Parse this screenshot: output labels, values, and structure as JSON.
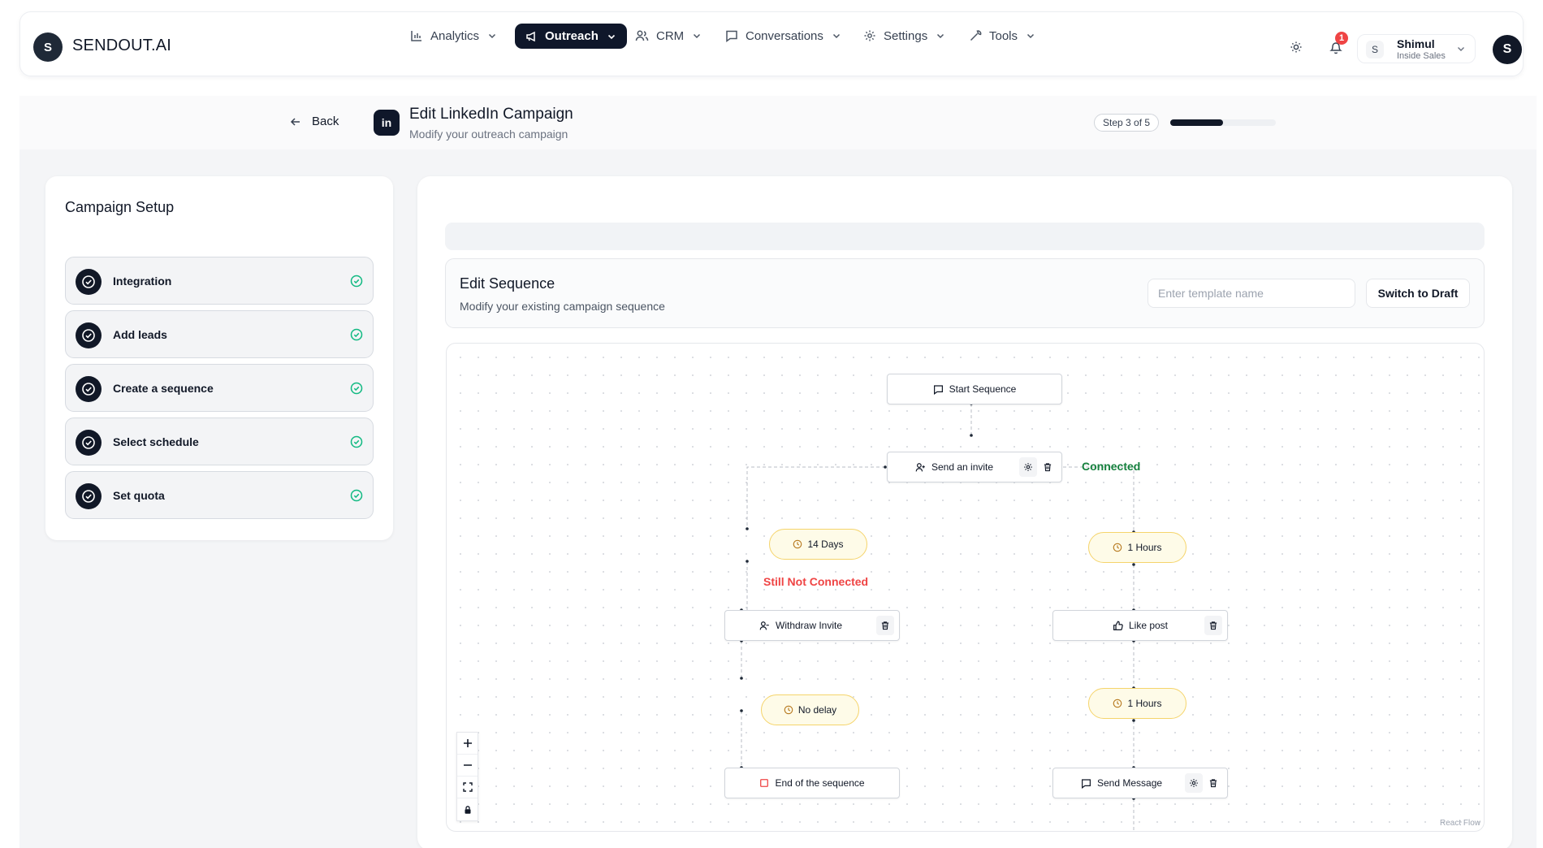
{
  "app": {
    "logo_letter": "S",
    "brand": "SENDOUT.AI"
  },
  "nav": {
    "items": [
      {
        "label": "Analytics",
        "icon": "bar-chart-icon"
      },
      {
        "label": "Outreach",
        "icon": "megaphone-icon",
        "active": true
      },
      {
        "label": "CRM",
        "icon": "users-icon"
      },
      {
        "label": "Conversations",
        "icon": "message-square-icon"
      },
      {
        "label": "Settings",
        "icon": "gear-icon"
      },
      {
        "label": "Tools",
        "icon": "wrench-icon"
      }
    ],
    "notification_count": "1",
    "user": {
      "initial": "S",
      "name": "Shimul",
      "role": "Inside Sales",
      "avatar": "S"
    }
  },
  "header": {
    "back_label": "Back",
    "badge_icon": "in",
    "title": "Edit LinkedIn Campaign",
    "subtitle": "Modify your outreach campaign",
    "step_label": "Step 3 of 5",
    "progress": 0.5
  },
  "setup": {
    "title": "Campaign Setup",
    "steps": [
      {
        "label": "Integration",
        "status": "complete"
      },
      {
        "label": "Add leads",
        "status": "complete"
      },
      {
        "label": "Create a sequence",
        "status": "complete"
      },
      {
        "label": "Select schedule",
        "status": "complete"
      },
      {
        "label": "Set quota",
        "status": "complete"
      }
    ]
  },
  "sequence": {
    "title": "Edit Sequence",
    "subtitle": "Modify your existing campaign sequence",
    "template_placeholder": "Enter template name",
    "switch_label": "Switch to Draft"
  },
  "flow": {
    "nodes": {
      "start": {
        "label": "Start Sequence",
        "icon": "message-square-icon"
      },
      "invite": {
        "label": "Send an invite",
        "icon": "user-plus-icon"
      },
      "withdraw": {
        "label": "Withdraw Invite",
        "icon": "user-minus-icon"
      },
      "like": {
        "label": "Like post",
        "icon": "thumbs-up-icon"
      },
      "end": {
        "label": "End of the sequence",
        "icon": "stop-square-icon"
      },
      "message": {
        "label": "Send Message",
        "icon": "message-square-icon"
      }
    },
    "delays": {
      "d14": "14 Days",
      "h1a": "1 Hours",
      "nodelay": "No delay",
      "h1b": "1 Hours"
    },
    "edge_labels": {
      "connected": "Connected",
      "not_connected": "Still Not Connected"
    },
    "attribution": "React Flow"
  },
  "colors": {
    "primary": "#0f172a",
    "success_check": "#10b981",
    "connected": "#15803d",
    "not_connected": "#ef4444",
    "delay_border": "#f5d46b",
    "delay_bg": "#fefbe8"
  }
}
